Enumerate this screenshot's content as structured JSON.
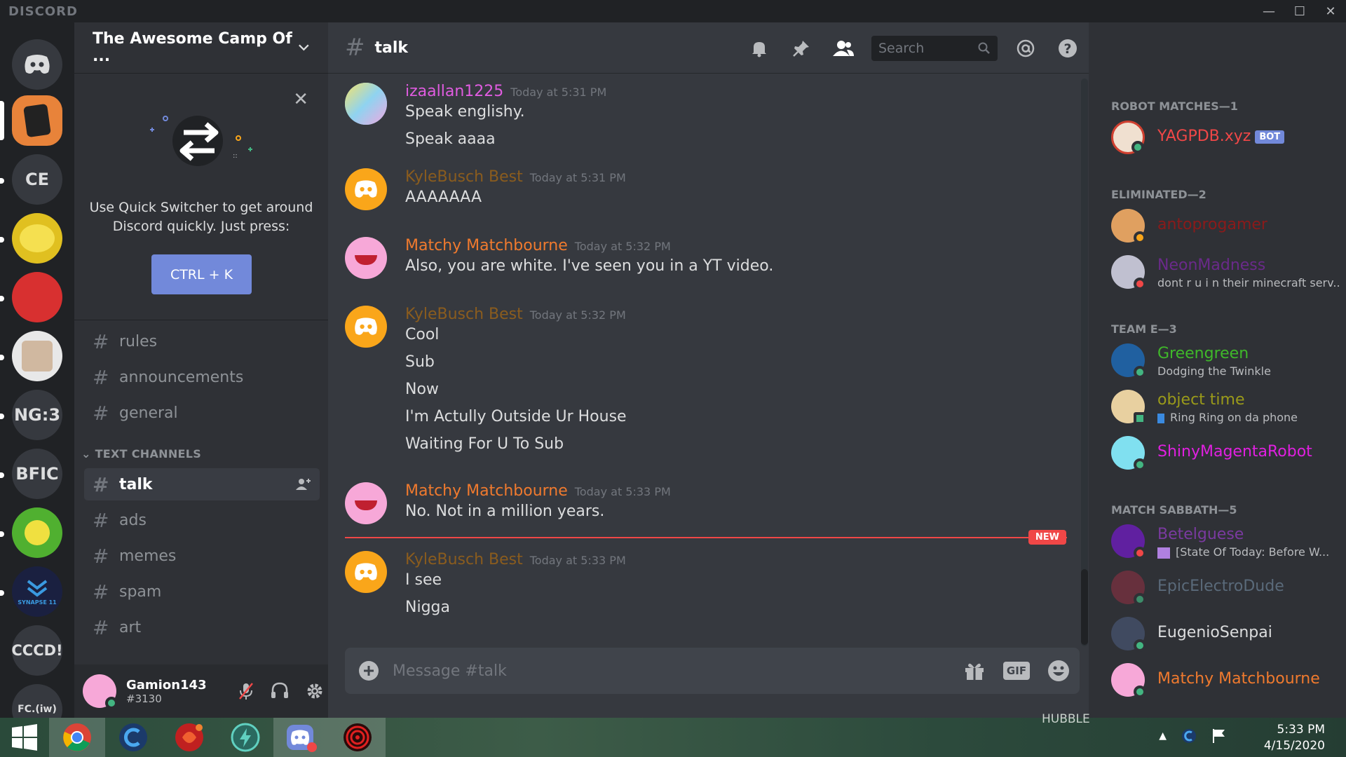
{
  "window": {
    "brand": "DISCORD",
    "controls": [
      "—",
      "☐",
      "✕"
    ]
  },
  "servers": [
    {
      "label": "",
      "kind": "home"
    },
    {
      "label": "",
      "kind": "image",
      "color": "#e8833a"
    },
    {
      "label": "CE",
      "kind": "text"
    },
    {
      "label": "",
      "kind": "image",
      "color": "#e0c020"
    },
    {
      "label": "",
      "kind": "image",
      "color": "#d83030"
    },
    {
      "label": "",
      "kind": "image",
      "color": "#e8e8e8"
    },
    {
      "label": "NG:3",
      "kind": "text"
    },
    {
      "label": "BFIC",
      "kind": "text"
    },
    {
      "label": "",
      "kind": "image",
      "color": "#50b030"
    },
    {
      "label": "SYNAPSE 11",
      "kind": "image",
      "color": "#1a2040"
    },
    {
      "label": "CCCD!",
      "kind": "text"
    },
    {
      "label": "FC.(iw)",
      "kind": "text"
    }
  ],
  "guild": {
    "name": "The Awesome Camp Of ..."
  },
  "quick_switcher": {
    "text": "Use Quick Switcher to get around Discord quickly. Just press:",
    "button": "CTRL + K"
  },
  "channels_top": [
    "rules",
    "announcements",
    "general"
  ],
  "category": "TEXT CHANNELS",
  "channels": [
    {
      "name": "talk",
      "active": true
    },
    {
      "name": "ads",
      "active": false
    },
    {
      "name": "memes",
      "active": false
    },
    {
      "name": "spam",
      "active": false
    },
    {
      "name": "art",
      "active": false
    }
  ],
  "user": {
    "name": "Gamion143",
    "tag": "#3130"
  },
  "channel": {
    "name": "talk"
  },
  "search": {
    "placeholder": "Search"
  },
  "composer": {
    "placeholder": "Message #talk",
    "gif": "GIF"
  },
  "messages": [
    {
      "author": "izaallan1225",
      "color": "#e05ce0",
      "time": "Today at 5:31 PM",
      "lines": [
        "Speak englishy.",
        "Speak aaaa"
      ],
      "avatar": "#8fd3f0"
    },
    {
      "author": "KyleBusch Best",
      "color": "#8a5c1e",
      "time": "Today at 5:31 PM",
      "lines": [
        "AAAAAAA"
      ],
      "avatar": "#faa61a"
    },
    {
      "author": "Matchy Matchbourne",
      "color": "#f07a2e",
      "time": "Today at 5:32 PM",
      "lines": [
        "Also, you are white. I've seen you in a YT video."
      ],
      "avatar": "#f7a8d8"
    },
    {
      "author": "KyleBusch Best",
      "color": "#8a5c1e",
      "time": "Today at 5:32 PM",
      "lines": [
        "Cool",
        "Sub",
        "Now",
        "I'm Actully Outside Ur House",
        "Waiting For U To Sub"
      ],
      "avatar": "#faa61a"
    },
    {
      "author": "Matchy Matchbourne",
      "color": "#f07a2e",
      "time": "Today at 5:33 PM",
      "lines": [
        "No. Not in a million years."
      ],
      "avatar": "#f7a8d8"
    },
    {
      "author": "KyleBusch Best",
      "color": "#8a5c1e",
      "time": "Today at 5:33 PM",
      "lines": [
        "I see",
        "Nigga"
      ],
      "avatar": "#faa61a"
    }
  ],
  "new_label": "NEW",
  "member_groups": [
    {
      "title": "ROBOT MATCHES—1",
      "members": [
        {
          "name": "YAGPDB.xyz",
          "color": "#f04747",
          "bot": "BOT",
          "sub": "",
          "status": "#43b581",
          "avatar": "#f0e0d0"
        }
      ]
    },
    {
      "title": "ELIMINATED—2",
      "members": [
        {
          "name": "antoprogamer",
          "color": "#8b1a1a",
          "sub": "",
          "status": "#faa61a",
          "avatar": "#e0a060"
        },
        {
          "name": "NeonMadness",
          "color": "#6a2a8a",
          "sub": "dont r u i n their minecraft serv...",
          "status": "#f04747",
          "avatar": "#c0c0d0"
        }
      ]
    },
    {
      "title": "TEAM E—3",
      "members": [
        {
          "name": "Greengreen",
          "color": "#3fb82a",
          "sub": "Dodging the Twinkle",
          "status": "#43b581",
          "avatar": "#2060a0"
        },
        {
          "name": "object time",
          "color": "#9a9a1a",
          "sub": "Ring Ring on da phone",
          "status": "#43b581",
          "avatar": "#e8d0a0"
        },
        {
          "name": "ShinyMagentaRobot",
          "color": "#e020e0",
          "sub": "",
          "status": "#43b581",
          "avatar": "#80e0f0"
        }
      ]
    },
    {
      "title": "MATCH SABBATH—5",
      "members": [
        {
          "name": "Betelguese",
          "color": "#7a3aa0",
          "sub": "[State Of Today: Before W...",
          "status": "#f04747",
          "avatar": "#6020a0"
        },
        {
          "name": "EpicElectroDude",
          "color": "#5a6a7a",
          "sub": "",
          "status": "#43b581",
          "avatar": "#803040"
        },
        {
          "name": "EugenioSenpai",
          "color": "#dcddde",
          "sub": "",
          "status": "#43b581",
          "avatar": "#404a60"
        },
        {
          "name": "Matchy Matchbourne",
          "color": "#f07a2e",
          "sub": "",
          "status": "#43b581",
          "avatar": "#f7a8d8"
        }
      ]
    }
  ],
  "taskbar": {
    "clock_time": "5:33 PM",
    "clock_date": "4/15/2020",
    "wallpaper_text": "HUBBLE"
  }
}
